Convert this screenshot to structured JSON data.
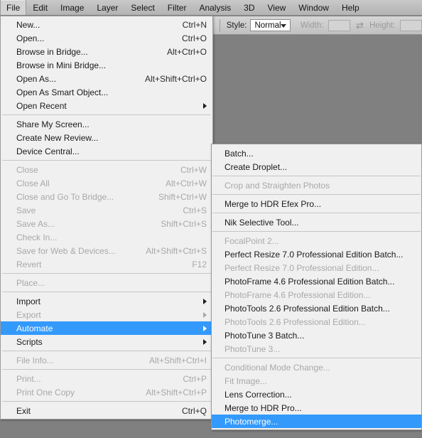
{
  "colors": {
    "highlight": "#3399fb",
    "menu_bg": "#f0f0f0",
    "menubar_bg": "#bdbdbd",
    "canvas": "#808080",
    "disabled_text": "#a8a8a8"
  },
  "menubar": {
    "items": [
      {
        "label": "File",
        "active": true
      },
      {
        "label": "Edit",
        "active": false
      },
      {
        "label": "Image",
        "active": false
      },
      {
        "label": "Layer",
        "active": false
      },
      {
        "label": "Select",
        "active": false
      },
      {
        "label": "Filter",
        "active": false
      },
      {
        "label": "Analysis",
        "active": false
      },
      {
        "label": "3D",
        "active": false
      },
      {
        "label": "View",
        "active": false
      },
      {
        "label": "Window",
        "active": false
      },
      {
        "label": "Help",
        "active": false
      }
    ]
  },
  "options_bar": {
    "style_label": "Style:",
    "style_value": "Normal",
    "width_label": "Width:",
    "width_value": "",
    "height_label": "Height:",
    "height_value": "",
    "swap_icon": "swap-dimensions-icon"
  },
  "file_menu": {
    "rows": [
      {
        "type": "item",
        "label": "New...",
        "shortcut": "Ctrl+N",
        "disabled": false,
        "submenu": false
      },
      {
        "type": "item",
        "label": "Open...",
        "shortcut": "Ctrl+O",
        "disabled": false,
        "submenu": false
      },
      {
        "type": "item",
        "label": "Browse in Bridge...",
        "shortcut": "Alt+Ctrl+O",
        "disabled": false,
        "submenu": false
      },
      {
        "type": "item",
        "label": "Browse in Mini Bridge...",
        "shortcut": "",
        "disabled": false,
        "submenu": false
      },
      {
        "type": "item",
        "label": "Open As...",
        "shortcut": "Alt+Shift+Ctrl+O",
        "disabled": false,
        "submenu": false
      },
      {
        "type": "item",
        "label": "Open As Smart Object...",
        "shortcut": "",
        "disabled": false,
        "submenu": false
      },
      {
        "type": "item",
        "label": "Open Recent",
        "shortcut": "",
        "disabled": false,
        "submenu": true
      },
      {
        "type": "separator"
      },
      {
        "type": "item",
        "label": "Share My Screen...",
        "shortcut": "",
        "disabled": false,
        "submenu": false
      },
      {
        "type": "item",
        "label": "Create New Review...",
        "shortcut": "",
        "disabled": false,
        "submenu": false
      },
      {
        "type": "item",
        "label": "Device Central...",
        "shortcut": "",
        "disabled": false,
        "submenu": false
      },
      {
        "type": "separator"
      },
      {
        "type": "item",
        "label": "Close",
        "shortcut": "Ctrl+W",
        "disabled": true,
        "submenu": false
      },
      {
        "type": "item",
        "label": "Close All",
        "shortcut": "Alt+Ctrl+W",
        "disabled": true,
        "submenu": false
      },
      {
        "type": "item",
        "label": "Close and Go To Bridge...",
        "shortcut": "Shift+Ctrl+W",
        "disabled": true,
        "submenu": false
      },
      {
        "type": "item",
        "label": "Save",
        "shortcut": "Ctrl+S",
        "disabled": true,
        "submenu": false
      },
      {
        "type": "item",
        "label": "Save As...",
        "shortcut": "Shift+Ctrl+S",
        "disabled": true,
        "submenu": false
      },
      {
        "type": "item",
        "label": "Check In...",
        "shortcut": "",
        "disabled": true,
        "submenu": false
      },
      {
        "type": "item",
        "label": "Save for Web & Devices...",
        "shortcut": "Alt+Shift+Ctrl+S",
        "disabled": true,
        "submenu": false
      },
      {
        "type": "item",
        "label": "Revert",
        "shortcut": "F12",
        "disabled": true,
        "submenu": false
      },
      {
        "type": "separator"
      },
      {
        "type": "item",
        "label": "Place...",
        "shortcut": "",
        "disabled": true,
        "submenu": false
      },
      {
        "type": "separator"
      },
      {
        "type": "item",
        "label": "Import",
        "shortcut": "",
        "disabled": false,
        "submenu": true
      },
      {
        "type": "item",
        "label": "Export",
        "shortcut": "",
        "disabled": true,
        "submenu": true
      },
      {
        "type": "item",
        "label": "Automate",
        "shortcut": "",
        "disabled": false,
        "submenu": true,
        "highlight": true
      },
      {
        "type": "item",
        "label": "Scripts",
        "shortcut": "",
        "disabled": false,
        "submenu": true
      },
      {
        "type": "separator"
      },
      {
        "type": "item",
        "label": "File Info...",
        "shortcut": "Alt+Shift+Ctrl+I",
        "disabled": true,
        "submenu": false
      },
      {
        "type": "separator"
      },
      {
        "type": "item",
        "label": "Print...",
        "shortcut": "Ctrl+P",
        "disabled": true,
        "submenu": false
      },
      {
        "type": "item",
        "label": "Print One Copy",
        "shortcut": "Alt+Shift+Ctrl+P",
        "disabled": true,
        "submenu": false
      },
      {
        "type": "separator"
      },
      {
        "type": "item",
        "label": "Exit",
        "shortcut": "Ctrl+Q",
        "disabled": false,
        "submenu": false
      }
    ]
  },
  "automate_submenu": {
    "rows": [
      {
        "type": "item",
        "label": "Batch...",
        "shortcut": "",
        "disabled": false,
        "submenu": false
      },
      {
        "type": "item",
        "label": "Create Droplet...",
        "shortcut": "",
        "disabled": false,
        "submenu": false
      },
      {
        "type": "separator"
      },
      {
        "type": "item",
        "label": "Crop and Straighten Photos",
        "shortcut": "",
        "disabled": true,
        "submenu": false
      },
      {
        "type": "separator"
      },
      {
        "type": "item",
        "label": "Merge to HDR Efex Pro...",
        "shortcut": "",
        "disabled": false,
        "submenu": false
      },
      {
        "type": "separator"
      },
      {
        "type": "item",
        "label": "Nik Selective Tool...",
        "shortcut": "",
        "disabled": false,
        "submenu": false
      },
      {
        "type": "separator"
      },
      {
        "type": "item",
        "label": "FocalPoint 2...",
        "shortcut": "",
        "disabled": true,
        "submenu": false
      },
      {
        "type": "item",
        "label": "Perfect Resize 7.0 Professional Edition Batch...",
        "shortcut": "",
        "disabled": false,
        "submenu": false
      },
      {
        "type": "item",
        "label": "Perfect Resize 7.0 Professional Edition...",
        "shortcut": "",
        "disabled": true,
        "submenu": false
      },
      {
        "type": "item",
        "label": "PhotoFrame 4.6 Professional Edition Batch...",
        "shortcut": "",
        "disabled": false,
        "submenu": false
      },
      {
        "type": "item",
        "label": "PhotoFrame 4.6 Professional Edition...",
        "shortcut": "",
        "disabled": true,
        "submenu": false
      },
      {
        "type": "item",
        "label": "PhotoTools 2.6 Professional Edition Batch...",
        "shortcut": "",
        "disabled": false,
        "submenu": false
      },
      {
        "type": "item",
        "label": "PhotoTools 2.6 Professional Edition...",
        "shortcut": "",
        "disabled": true,
        "submenu": false
      },
      {
        "type": "item",
        "label": "PhotoTune 3 Batch...",
        "shortcut": "",
        "disabled": false,
        "submenu": false
      },
      {
        "type": "item",
        "label": "PhotoTune 3...",
        "shortcut": "",
        "disabled": true,
        "submenu": false
      },
      {
        "type": "separator"
      },
      {
        "type": "item",
        "label": "Conditional Mode Change...",
        "shortcut": "",
        "disabled": true,
        "submenu": false
      },
      {
        "type": "item",
        "label": "Fit Image...",
        "shortcut": "",
        "disabled": true,
        "submenu": false
      },
      {
        "type": "item",
        "label": "Lens Correction...",
        "shortcut": "",
        "disabled": false,
        "submenu": false
      },
      {
        "type": "item",
        "label": "Merge to HDR Pro...",
        "shortcut": "",
        "disabled": false,
        "submenu": false
      },
      {
        "type": "item",
        "label": "Photomerge...",
        "shortcut": "",
        "disabled": false,
        "submenu": false,
        "highlight": true
      }
    ]
  }
}
